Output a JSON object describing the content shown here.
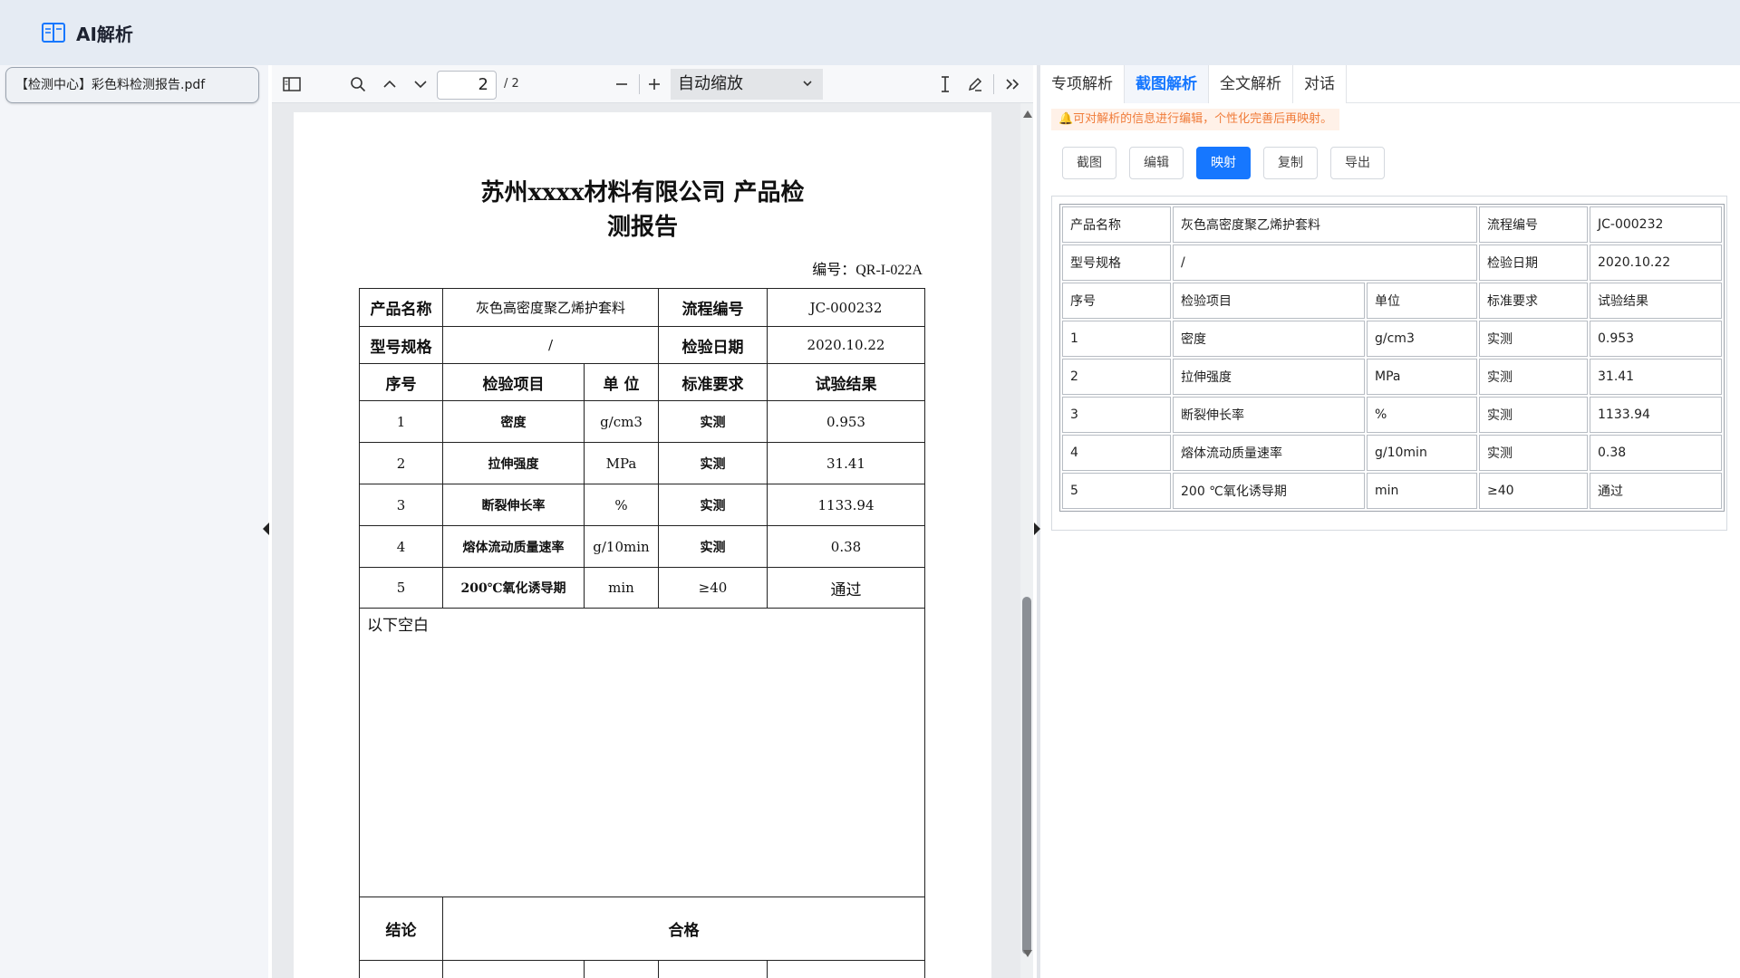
{
  "app": {
    "title": "AI解析"
  },
  "files": {
    "items": [
      {
        "label": "【检测中心】彩色料检测报告.pdf"
      }
    ]
  },
  "pdf_toolbar": {
    "page_current": "2",
    "page_total": "/ 2",
    "zoom": "自动缩放",
    "icons": [
      "sidebar-toggle-icon",
      "search-icon",
      "chevron-up-icon",
      "chevron-down-icon",
      "zoom-out-icon",
      "zoom-in-icon",
      "text-cursor-icon",
      "pen-icon",
      "double-chevron-right-icon"
    ]
  },
  "document": {
    "title_line1": "苏州xxxx材料有限公司 产品检",
    "title_line2": "测报告",
    "number": "编号：QR-I-022A",
    "header": {
      "product_name_label": "产品名称",
      "product_name": "灰色高密度聚乙烯护套料",
      "flow_no_label": "流程编号",
      "flow_no": "JC-000232",
      "model_label": "型号规格",
      "model": "/",
      "date_label": "检验日期",
      "date": "2020.10.22"
    },
    "columns": [
      "序号",
      "检验项目",
      "单 位",
      "标准要求",
      "试验结果"
    ],
    "rows": [
      {
        "no": "1",
        "item": "密度",
        "unit": "g/cm3",
        "req": "实测",
        "result": "0.953"
      },
      {
        "no": "2",
        "item": "拉伸强度",
        "unit": "MPa",
        "req": "实测",
        "result": "31.41"
      },
      {
        "no": "3",
        "item": "断裂伸长率",
        "unit": "%",
        "req": "实测",
        "result": "1133.94"
      },
      {
        "no": "4",
        "item": "熔体流动质量速率",
        "unit": "g/10min",
        "req": "实测",
        "result": "0.38"
      },
      {
        "no": "5",
        "item": "200℃氧化诱导期",
        "unit": "min",
        "req": "≥40",
        "result": "通过"
      }
    ],
    "blank_note": "以下空白",
    "conclusion_label": "结论",
    "conclusion": "合格"
  },
  "right_panel": {
    "tabs": [
      "专项解析",
      "截图解析",
      "全文解析",
      "对话"
    ],
    "active_tab": "截图解析",
    "tip": "🔔可对解析的信息进行编辑，个性化完善后再映射。",
    "buttons": [
      "截图",
      "编辑",
      "映射",
      "复制",
      "导出"
    ],
    "primary_button": "映射",
    "table": {
      "header": {
        "product_name_label": "产品名称",
        "product_name": "灰色高密度聚乙烯护套料",
        "flow_no_label": "流程编号",
        "flow_no": "JC-000232",
        "model_label": "型号规格",
        "model": "/",
        "date_label": "检验日期",
        "date": "2020.10.22"
      },
      "columns": [
        "序号",
        "检验项目",
        "单位",
        "标准要求",
        "试验结果"
      ],
      "rows": [
        {
          "no": "1",
          "item": "密度",
          "unit": "g/cm3",
          "req": "实测",
          "result": "0.953"
        },
        {
          "no": "2",
          "item": "拉伸强度",
          "unit": "MPa",
          "req": "实测",
          "result": "31.41"
        },
        {
          "no": "3",
          "item": "断裂伸长率",
          "unit": "%",
          "req": "实测",
          "result": "1133.94"
        },
        {
          "no": "4",
          "item": "熔体流动质量速率",
          "unit": "g/10min",
          "req": "实测",
          "result": "0.38"
        },
        {
          "no": "5",
          "item": "200 ℃氧化诱导期",
          "unit": "min",
          "req": "≥40",
          "result": "通过"
        }
      ]
    }
  },
  "colors": {
    "accent": "#1677ff",
    "header_bg": "#e5ebf3",
    "tip_text": "#f07c3a",
    "tip_bg": "#fff1e8"
  }
}
